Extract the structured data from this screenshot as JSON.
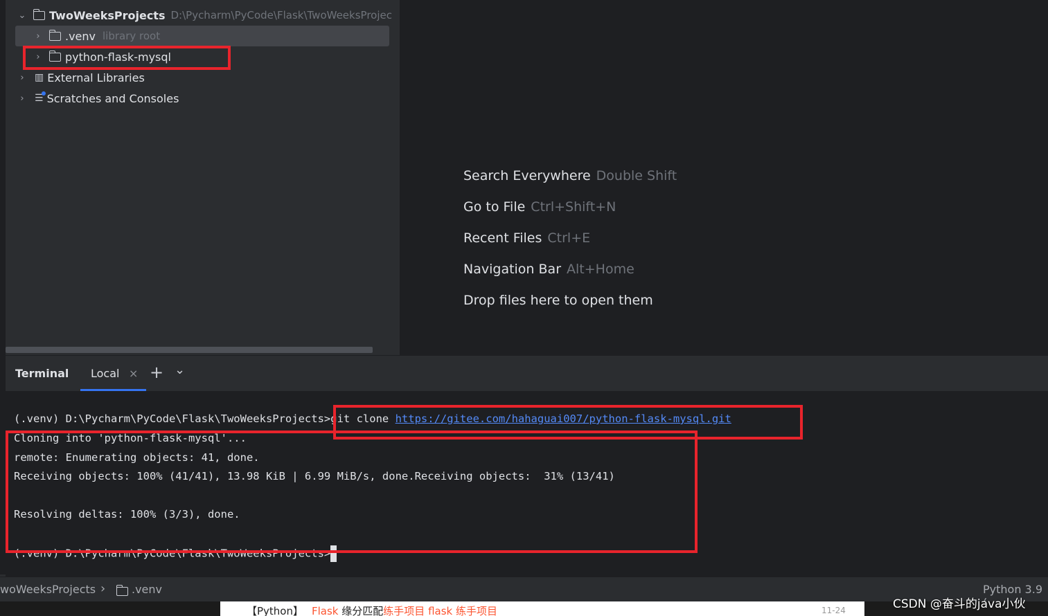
{
  "project_tree": {
    "root": {
      "name": "TwoWeeksProjects",
      "path": "D:\\Pycharm\\PyCode\\Flask\\TwoWeeksProjec"
    },
    "items": [
      {
        "name": ".venv",
        "note": "library root"
      },
      {
        "name": "python-flask-mysql"
      },
      {
        "name": "External Libraries"
      },
      {
        "name": "Scratches and Consoles"
      }
    ]
  },
  "editor_hints": [
    {
      "label": "Search Everywhere",
      "shortcut": "Double Shift"
    },
    {
      "label": "Go to File",
      "shortcut": "Ctrl+Shift+N"
    },
    {
      "label": "Recent Files",
      "shortcut": "Ctrl+E"
    },
    {
      "label": "Navigation Bar",
      "shortcut": "Alt+Home"
    },
    {
      "label": "Drop files here to open them",
      "shortcut": ""
    }
  ],
  "terminal": {
    "title": "Terminal",
    "tab": "Local",
    "close_icon": "×",
    "add_icon": "+",
    "dropdown_icon": "⌄",
    "prompt": "(.venv) D:\\Pycharm\\PyCode\\Flask\\TwoWeeksProjects>",
    "command": "git clone ",
    "url": "https://gitee.com/hahaguai007/python-flask-mysql.git",
    "output": [
      "Cloning into 'python-flask-mysql'...",
      "remote: Enumerating objects: 41, done.",
      "Receiving objects: 100% (41/41), 13.98 KiB | 6.99 MiB/s, done.Receiving objects:  31% (13/41)",
      "Resolving deltas: 100% (3/3), done."
    ],
    "final_prompt": "(.venv) D:\\Pycharm\\PyCode\\Flask\\TwoWeeksProjects>"
  },
  "statusbar": {
    "breadcrumb_project": "woWeeksProjects",
    "breadcrumb_sep": "›",
    "breadcrumb_folder": ".venv",
    "interpreter": "Python 3.9 ("
  },
  "web_strip": {
    "tag": "【Python】",
    "parts": [
      "Flask",
      " 缘分匹配",
      "练手项目",
      " flask 练手项目"
    ],
    "date": "11-24"
  },
  "watermark": "CSDN @奋斗的java小伙",
  "colors": {
    "accent": "#3574f0",
    "highlight_box": "#e8242c",
    "link": "#548af7"
  }
}
